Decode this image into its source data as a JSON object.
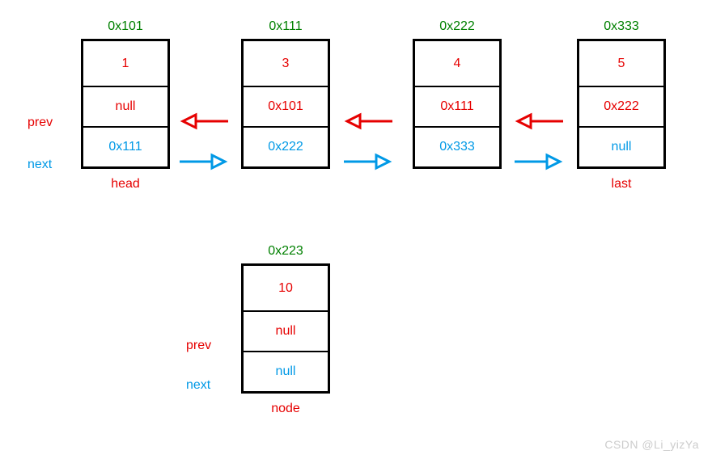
{
  "nodes": {
    "n1": {
      "address": "0x101",
      "value": "1",
      "prev": "null",
      "next": "0x111",
      "label": "head"
    },
    "n2": {
      "address": "0x111",
      "value": "3",
      "prev": "0x101",
      "next": "0x222",
      "label": ""
    },
    "n3": {
      "address": "0x222",
      "value": "4",
      "prev": "0x111",
      "next": "0x333",
      "label": ""
    },
    "n4": {
      "address": "0x333",
      "value": "5",
      "prev": "0x222",
      "next": "null",
      "label": "last"
    },
    "n5": {
      "address": "0x223",
      "value": "10",
      "prev": "null",
      "next": "null",
      "label": "node"
    }
  },
  "side_labels": {
    "prev": "prev",
    "next": "next",
    "prev2": "prev",
    "next2": "next"
  },
  "watermark": "CSDN @Li_yizYa"
}
